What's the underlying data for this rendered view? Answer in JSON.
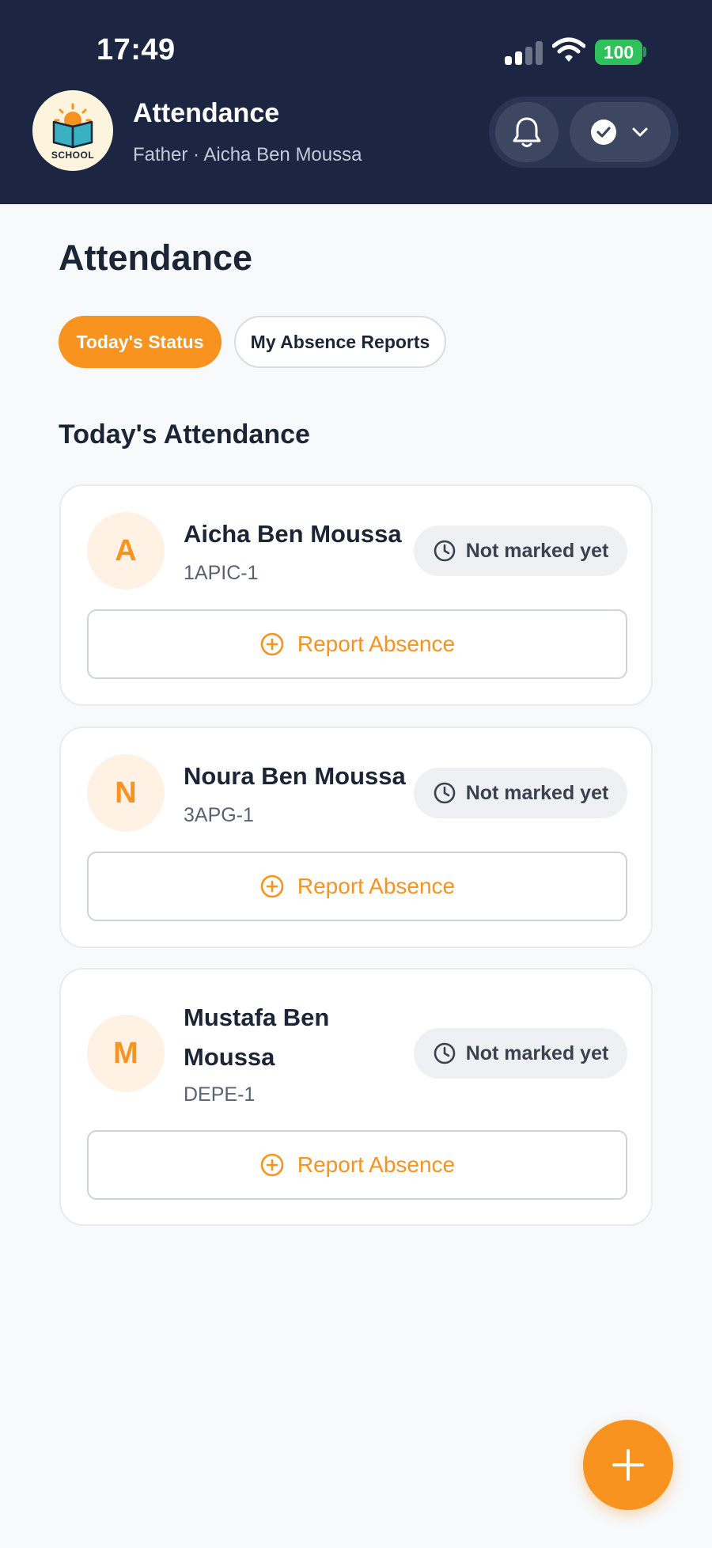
{
  "status_bar": {
    "time": "17:49",
    "battery": "100"
  },
  "header": {
    "logo_text": "SCHOOL",
    "title": "Attendance",
    "subtitle": "Father · Aicha Ben Moussa",
    "icons": [
      "bell-icon",
      "check-circle-icon",
      "chevron-down-icon"
    ]
  },
  "main": {
    "page_title": "Attendance",
    "tabs": [
      {
        "label": "Today's Status",
        "active": true
      },
      {
        "label": "My Absence Reports",
        "active": false
      }
    ],
    "section_title": "Today's Attendance",
    "students": [
      {
        "initial": "A",
        "name": "Aicha Ben Moussa",
        "class": "1APIC-1",
        "status": "Not marked yet",
        "action": "Report Absence"
      },
      {
        "initial": "N",
        "name": "Noura Ben Moussa",
        "class": "3APG-1",
        "status": "Not marked yet",
        "action": "Report Absence"
      },
      {
        "initial": "M",
        "name": "Mustafa Ben Moussa",
        "class": "DEPE-1",
        "status": "Not marked yet",
        "action": "Report Absence"
      }
    ]
  },
  "colors": {
    "header_bg": "#1c2642",
    "accent": "#f7931e",
    "battery": "#2fc25b",
    "page_bg": "#f7f9fb"
  }
}
